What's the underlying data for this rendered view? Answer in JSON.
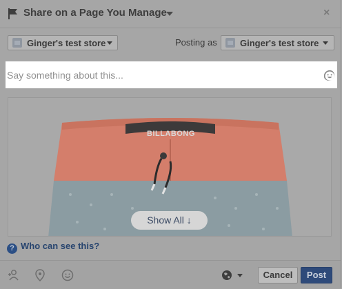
{
  "header": {
    "title": "Share on a Page You Manage",
    "close_glyph": "×",
    "flag_icon": "flag-icon"
  },
  "page_row": {
    "page_selector_label": "Ginger's test store",
    "posting_as_label": "Posting as",
    "identity_selector_label": "Ginger's test store"
  },
  "composer": {
    "placeholder": "Say something about this...",
    "emoji_icon": "emoji-icon"
  },
  "attachment": {
    "show_all_label": "Show All ↓",
    "brand_text": "BILLABONG"
  },
  "privacy": {
    "who_can_see_label": "Who can see this?"
  },
  "footer": {
    "cancel_label": "Cancel",
    "post_label": "Post"
  },
  "colors": {
    "post_button": "#2e4a7a",
    "link": "#28456f",
    "shorts_top": "#d9826f",
    "shorts_bottom": "#8a9aa0"
  }
}
